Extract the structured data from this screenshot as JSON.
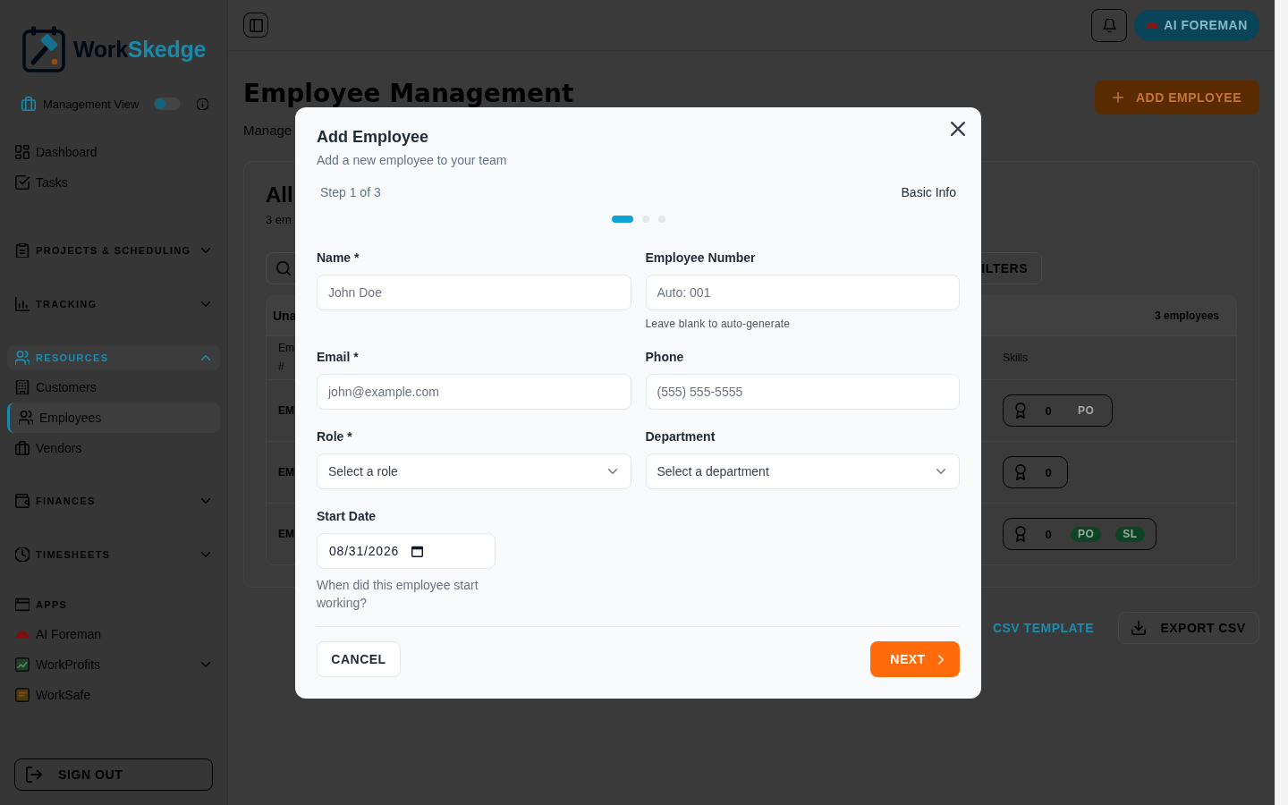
{
  "top_bar": {
    "ai_button": "AI FOREMAN"
  },
  "sidebar": {
    "logo": {
      "parts": [
        "Work",
        "Skedge"
      ]
    },
    "view_toggle": {
      "label": "Management View",
      "on": false
    },
    "items": [
      {
        "label": "Dashboard",
        "selected": false
      },
      {
        "label": "Tasks",
        "selected": false
      }
    ],
    "sections": [
      {
        "kind": "group",
        "label": "PROJECTS & SCHEDULING",
        "active": false,
        "expanded": false
      },
      {
        "kind": "group",
        "label": "TRACKING",
        "active": false,
        "expanded": false
      },
      {
        "kind": "group",
        "label": "RESOURCES",
        "active": true,
        "expanded": true,
        "children": [
          {
            "label": "Customers",
            "selected": false
          },
          {
            "label": "Employees",
            "selected": true
          },
          {
            "label": "Vendors",
            "selected": false
          }
        ]
      },
      {
        "kind": "group",
        "label": "FINANCES",
        "active": false,
        "expanded": false
      },
      {
        "kind": "group",
        "label": "TIMESHEETS",
        "active": false,
        "expanded": false
      },
      {
        "kind": "heading",
        "label": "APPS",
        "active": false,
        "children": [
          {
            "label": "AI Foreman",
            "selected": false
          },
          {
            "label": "WorkProfits",
            "selected": false,
            "expanded": false
          },
          {
            "label": "WorkSafe",
            "selected": false
          }
        ]
      }
    ],
    "sign_out": "SIGN OUT"
  },
  "page_header": {
    "title": "Employee Management",
    "subtitle": "Manage",
    "add_button": "ADD EMPLOYEE"
  },
  "employees_card": {
    "title": "All",
    "subtitle": "3 em",
    "filters_button": "ILTERS",
    "group": {
      "title": "Una",
      "count": "3 employees",
      "columns": [
        "Em #",
        "Skills"
      ],
      "rows": [
        {
          "cell": "EM",
          "skills": {
            "count": "0",
            "tags": [
              {
                "label": "PO",
                "color": "#3b3b3b"
              }
            ]
          }
        },
        {
          "cell": "EM",
          "skills": {
            "count": "0"
          }
        },
        {
          "cell": "EM",
          "skills": {
            "count": "0",
            "tags": [
              {
                "label": "PO",
                "color": "#0e4424"
              },
              {
                "label": "SL",
                "color": "#0e4424"
              }
            ]
          }
        }
      ]
    }
  },
  "actions": {
    "csv_template": "CSV TEMPLATE",
    "export_button": "EXPORT CSV"
  },
  "modal": {
    "title": "Add Employee",
    "subtitle": "Add a new employee to your team",
    "step_label": "Step 1 of 3",
    "step_name": "Basic Info",
    "steps": [
      {
        "selected": true
      },
      {
        "selected": false
      },
      {
        "selected": false
      }
    ],
    "fields": [
      {
        "kind": "text",
        "label": "Name *",
        "placeholder": "John Doe"
      },
      {
        "kind": "text",
        "label": "Employee Number",
        "placeholder": "Auto: 001",
        "hint": "Leave blank to auto-generate"
      },
      {
        "kind": "text",
        "label": "Email *",
        "placeholder": "john@example.com"
      },
      {
        "kind": "text",
        "label": "Phone",
        "placeholder": "(555) 555-5555"
      },
      {
        "kind": "select",
        "label": "Role *",
        "placeholder": "Select a role"
      },
      {
        "kind": "select",
        "label": "Department",
        "placeholder": "Select a department"
      },
      {
        "kind": "date",
        "label": "Start Date",
        "value": "08/31/2026",
        "hint": "When did this employee start working?"
      }
    ],
    "cancel_button": "CANCEL",
    "next_button": "NEXT"
  }
}
